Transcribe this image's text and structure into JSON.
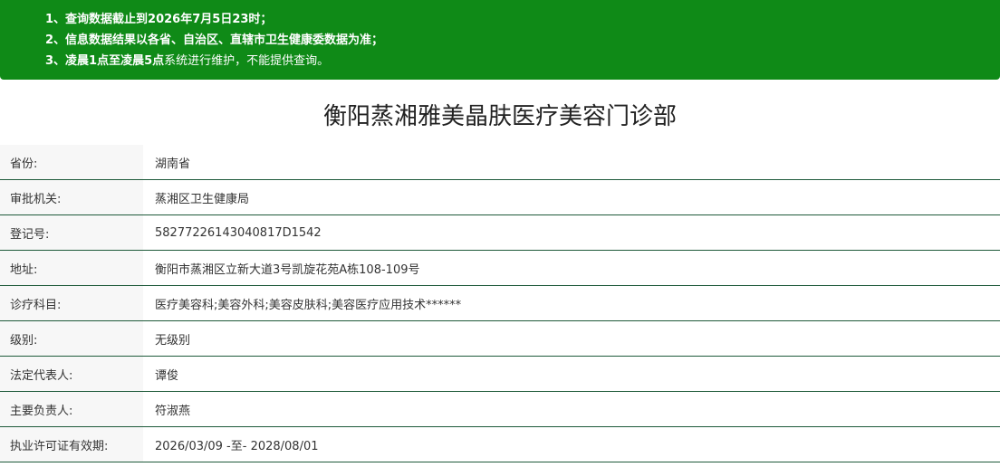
{
  "notice": {
    "line1_prefix": "1、查询数据截止到",
    "line1_bold": "2026年7月5日23时；",
    "line2": "2、信息数据结果以各省、自治区、直辖市卫生健康委数据为准；",
    "line3_prefix": "3、",
    "line3_bold": "凌晨1点至凌晨5点",
    "line3_suffix": "系统进行维护，不能提供查询。"
  },
  "title": "衡阳蒸湘雅美晶肤医疗美容门诊部",
  "rows": [
    {
      "label": "省份:",
      "value": "湖南省"
    },
    {
      "label": "审批机关:",
      "value": "蒸湘区卫生健康局"
    },
    {
      "label": "登记号:",
      "value": "58277226143040817D1542"
    },
    {
      "label": "地址:",
      "value": "衡阳市蒸湘区立新大道3号凯旋花苑A栋108-109号"
    },
    {
      "label": "诊疗科目:",
      "value": "医疗美容科;美容外科;美容皮肤科;美容医疗应用技术******"
    },
    {
      "label": "级别:",
      "value": "无级别"
    },
    {
      "label": "法定代表人:",
      "value": "谭俊"
    },
    {
      "label": "主要负责人:",
      "value": "符淑燕"
    },
    {
      "label": "执业许可证有效期:",
      "value": "2026/03/09 -至- 2028/08/01"
    }
  ],
  "colors": {
    "notice_bg": "#0f8a17",
    "row_border": "#1e5a3a",
    "label_bg": "#f7f7f7"
  }
}
